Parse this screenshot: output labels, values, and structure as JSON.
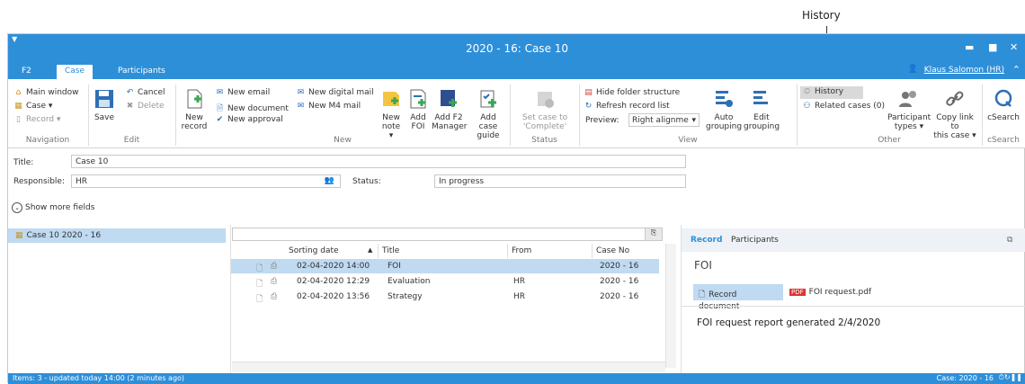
{
  "callout": {
    "label": "History"
  },
  "window": {
    "title": "2020 - 16: Case 10"
  },
  "tabs": [
    {
      "label": "F2"
    },
    {
      "label": "Case"
    },
    {
      "label": "Participants"
    }
  ],
  "user": {
    "name": "Klaus Salomon (HR)"
  },
  "ribbon": {
    "navigation": {
      "label": "Navigation",
      "items": [
        "Main window",
        "Case",
        "Record"
      ]
    },
    "edit": {
      "label": "Edit",
      "save": "Save",
      "cancel": "Cancel",
      "delete": "Delete"
    },
    "new": {
      "label": "New",
      "new_record_1": "New",
      "new_record_2": "record",
      "new_email": "New email",
      "new_document": "New document",
      "new_approval": "New approval",
      "new_digital_mail": "New digital mail",
      "new_m4_mail": "New M4 mail",
      "new_note_1": "New",
      "new_note_2": "note",
      "add_foi_1": "Add",
      "add_foi_2": "FOI",
      "add_f2_1": "Add F2",
      "add_f2_2": "Manager",
      "add_case_1": "Add case",
      "add_case_2": "guide"
    },
    "status": {
      "label": "Status",
      "line1": "Set case to",
      "line2": "'Complete'"
    },
    "view": {
      "label": "View",
      "hide_folder": "Hide folder structure",
      "refresh": "Refresh record list",
      "preview_label": "Preview:",
      "preview_value": "Right alignme",
      "auto_1": "Auto",
      "auto_2": "grouping",
      "edit_1": "Edit",
      "edit_2": "grouping"
    },
    "other": {
      "label": "Other",
      "history": "History",
      "related": "Related cases (0)",
      "ptypes_1": "Participant",
      "ptypes_2": "types",
      "copy_1": "Copy link to",
      "copy_2": "this case"
    },
    "csearch": {
      "label": "cSearch",
      "button": "cSearch"
    }
  },
  "form": {
    "title_label": "Title:",
    "title_value": "Case 10",
    "responsible_label": "Responsible:",
    "responsible_value": "HR",
    "status_label": "Status:",
    "status_value": "In progress",
    "show_more": "Show more fields"
  },
  "tree": {
    "item": "Case 10 2020 - 16"
  },
  "grid": {
    "headers": {
      "date": "Sorting date",
      "title": "Title",
      "from": "From",
      "case": "Case No"
    },
    "rows": [
      {
        "date": "02-04-2020 14:00",
        "title": "FOI",
        "from": "",
        "case": "2020 - 16"
      },
      {
        "date": "02-04-2020 12:29",
        "title": "Evaluation",
        "from": "HR",
        "case": "2020 - 16"
      },
      {
        "date": "02-04-2020 13:56",
        "title": "Strategy",
        "from": "HR",
        "case": "2020 - 16"
      }
    ]
  },
  "preview": {
    "tab_record": "Record",
    "tab_participants": "Participants",
    "title": "FOI",
    "doc_button": "Record document",
    "attachment": "FOI request.pdf",
    "body": "FOI request report generated 2/4/2020"
  },
  "statusbar": {
    "left": "Items: 3 - updated today 14:00 (2 minutes ago)",
    "right": "Case: 2020 - 16"
  },
  "colors": {
    "accent": "#2e8fd9",
    "selection": "#bfdaf1"
  }
}
